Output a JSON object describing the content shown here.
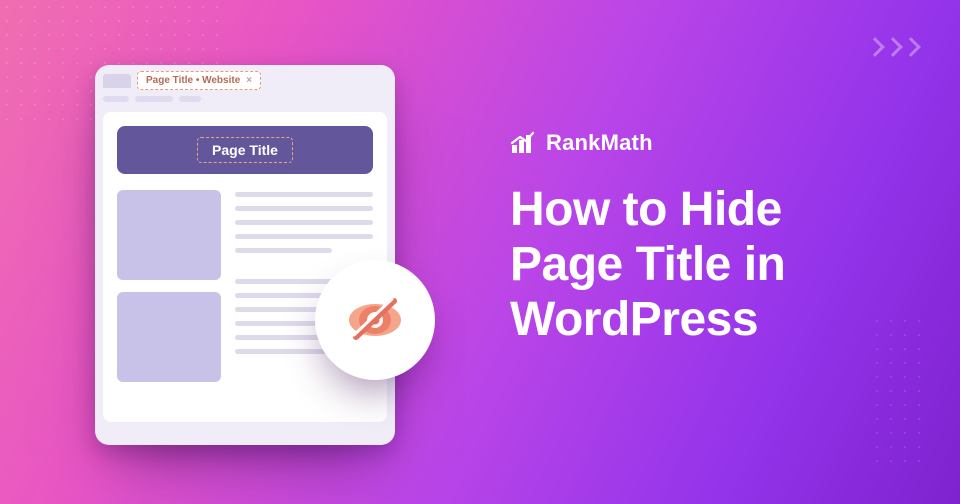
{
  "browser": {
    "tab_label": "Page Title  • Website",
    "page_title": "Page Title"
  },
  "brand": {
    "name": "RankMath"
  },
  "headline": {
    "l1": "How to Hide",
    "l2": "Page Title in",
    "l3": "WordPress"
  },
  "icons": {
    "hide": "hide-eye-icon",
    "logo": "rankmath-logo-icon"
  }
}
